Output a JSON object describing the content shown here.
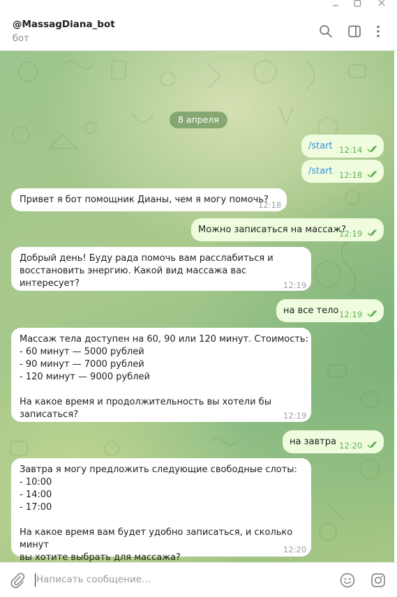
{
  "window": {
    "minimize_icon": "minimize-icon",
    "maximize_icon": "maximize-icon",
    "close_icon": "close-icon"
  },
  "header": {
    "title": "@MassagDiana_bot",
    "subtitle": "бот",
    "icons": [
      "search-icon",
      "sidebar-toggle-icon",
      "more-vert-icon"
    ]
  },
  "date_divider": "8 апреля",
  "messages": [
    {
      "dir": "out",
      "text": "/start",
      "time": "12:14",
      "read": true
    },
    {
      "dir": "out",
      "text": "/start",
      "time": "12:18",
      "read": true
    },
    {
      "dir": "in",
      "text": "Привет я бот помощник Дианы, чем я могу помочь?",
      "time": "12:18"
    },
    {
      "dir": "out",
      "text": "Можно записаться на массаж?",
      "time": "12:19",
      "read": true
    },
    {
      "dir": "in",
      "text": "Добрый день! Буду рада помочь вам расслабиться и\nвосстановить энергию. Какой вид массажа вас интересует?",
      "time": "12:19"
    },
    {
      "dir": "out",
      "text": "на все тело",
      "time": "12:19",
      "read": true
    },
    {
      "dir": "in",
      "text": "Массаж тела доступен на 60, 90 или 120 минут. Стоимость:\n- 60 минут — 5000 рублей\n- 90 минут — 7000 рублей\n- 120 минут — 9000 рублей\n\nНа какое время и продолжительность вы хотели бы записаться?",
      "time": "12:19"
    },
    {
      "dir": "out",
      "text": "на завтра",
      "time": "12:20",
      "read": true
    },
    {
      "dir": "in",
      "text": "Завтра я могу предложить следующие свободные слоты:\n- 10:00\n- 14:00\n- 17:00\n\nНа какое время вам будет удобно записаться, и сколько минут\nвы хотите выбрать для массажа?",
      "time": "12:20"
    }
  ],
  "composer": {
    "placeholder": "Написать сообщение...",
    "icons": [
      "attach-icon",
      "emoji-icon",
      "camera-icon"
    ]
  },
  "colors": {
    "outgoing_bubble": "#effdde",
    "incoming_bubble": "#ffffff",
    "read_ticks": "#62ac55",
    "command_link": "#3a8fd6"
  }
}
